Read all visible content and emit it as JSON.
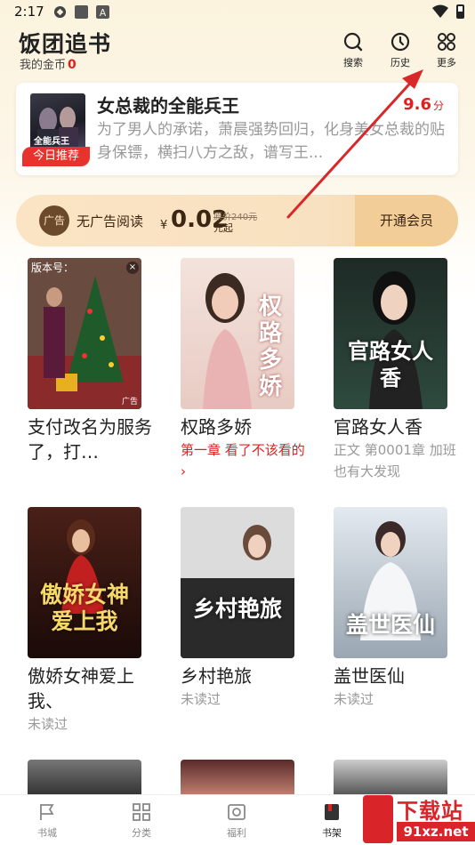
{
  "status_bar": {
    "time": "2:17"
  },
  "header": {
    "title": "饭团追书",
    "coins_label": "我的金币",
    "coins_value": "0",
    "buttons": [
      {
        "label": "搜索",
        "icon": "search-icon"
      },
      {
        "label": "历史",
        "icon": "clock-icon"
      },
      {
        "label": "更多",
        "icon": "grid-icon"
      }
    ]
  },
  "recommend": {
    "badge": "今日推荐",
    "title": "女总裁的全能兵王",
    "score": "9.6",
    "score_unit": "分",
    "description": "为了男人的承诺，萧晨强势回归，化身美女总裁的贴身保镖，横扫八方之敌，谱写王...",
    "cover_text": "全能兵王"
  },
  "vip_banner": {
    "icon_text": "广告",
    "label": "无广告阅读",
    "currency": "¥",
    "price": "0.02",
    "original_price": "原价240元",
    "suffix": "元起",
    "button": "开通会员"
  },
  "books": [
    {
      "title": "支付改名为服务了，打…",
      "subtitle": "",
      "is_ad": true,
      "ad_tag": "版本号：",
      "ad_label": "广告"
    },
    {
      "title": "权路多娇",
      "subtitle": "第一章 看了不该看的 ›",
      "subtitle_red": true,
      "cover_text": "权路多娇"
    },
    {
      "title": "官路女人香",
      "subtitle": "正文 第0001章 加班也有大发现",
      "cover_text": "官路女人香"
    },
    {
      "title": "傲娇女神爱上我、",
      "subtitle": "未读过",
      "cover_text": "傲娇女神爱上我"
    },
    {
      "title": "乡村艳旅",
      "subtitle": "未读过",
      "cover_text": "乡村艳旅"
    },
    {
      "title": "盖世医仙",
      "subtitle": "未读过",
      "cover_text": "盖世医仙"
    }
  ],
  "bottom_nav": [
    {
      "label": "书城",
      "icon": "flag-icon"
    },
    {
      "label": "分类",
      "icon": "category-grid-icon"
    },
    {
      "label": "福利",
      "icon": "gift-icon"
    },
    {
      "label": "书架",
      "icon": "bookshelf-icon",
      "active": true
    }
  ],
  "watermark": {
    "big": "下载站",
    "small": "91xz.net"
  },
  "colors": {
    "accent_red": "#e02020",
    "vip_brown": "#3a2612",
    "vip_bg": "#fbe4c3"
  }
}
